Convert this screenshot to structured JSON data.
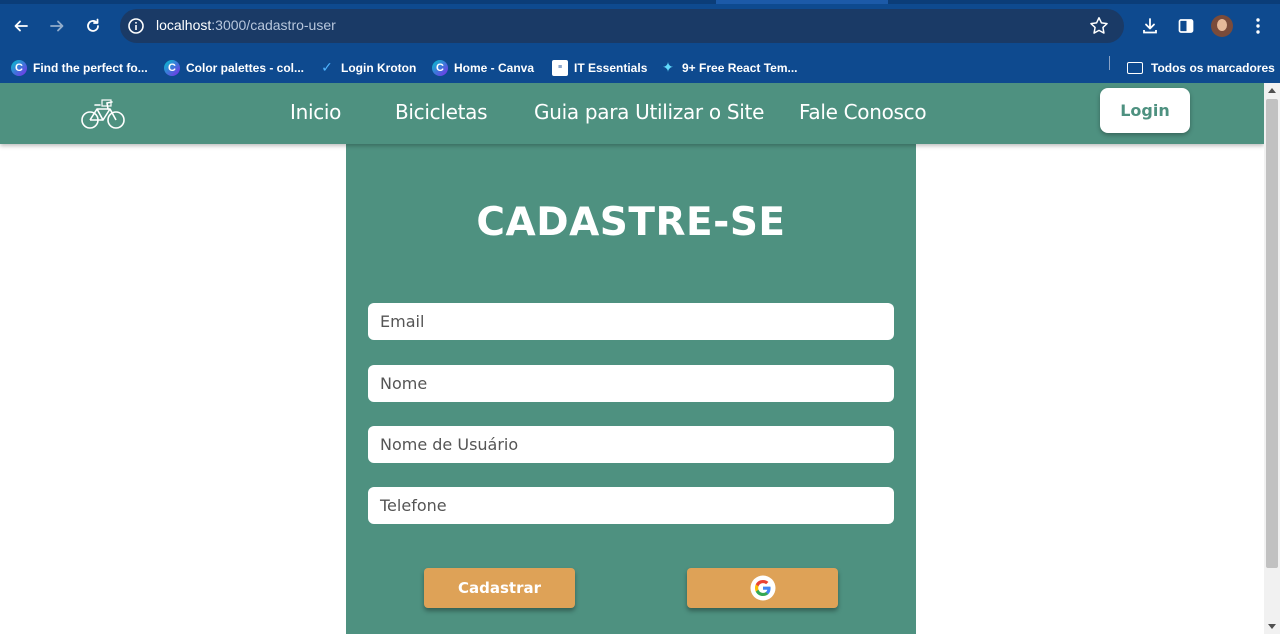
{
  "browser": {
    "url_host": "localhost",
    "url_path": ":3000/cadastro-user",
    "bookmarks": [
      {
        "label": "Find the perfect fo...",
        "icon": "canva-icon"
      },
      {
        "label": "Color palettes - col...",
        "icon": "canva-icon"
      },
      {
        "label": "Login Kroton",
        "icon": "kroton-icon"
      },
      {
        "label": "Home - Canva",
        "icon": "canva-icon"
      },
      {
        "label": "IT Essentials",
        "icon": "cisco-icon"
      },
      {
        "label": "9+ Free React Tem...",
        "icon": "react-icon"
      }
    ],
    "all_bookmarks_label": "Todos os marcadores"
  },
  "navbar": {
    "links": [
      "Inicio",
      "Bicicletas",
      "Guia para Utilizar o Site",
      "Fale Conosco"
    ],
    "login_label": "Login"
  },
  "form": {
    "title": "CADASTRE-SE",
    "fields": [
      {
        "placeholder": "Email"
      },
      {
        "placeholder": "Nome"
      },
      {
        "placeholder": "Nome de Usuário"
      },
      {
        "placeholder": "Telefone"
      }
    ],
    "submit_label": "Cadastrar",
    "google_button_icon": "google-icon"
  },
  "colors": {
    "primary": "#4e9180",
    "button": "#dea257",
    "browser": "#0e4a8f"
  }
}
